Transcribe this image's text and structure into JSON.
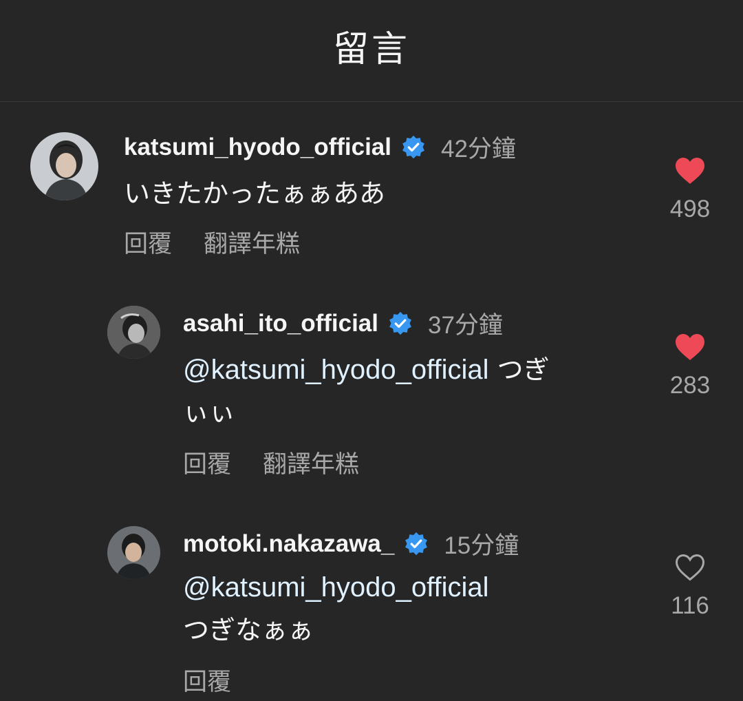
{
  "header": {
    "title": "留言"
  },
  "comments": [
    {
      "username": "katsumi_hyodo_official",
      "verified": true,
      "time": "42分鐘",
      "mention": "",
      "text": "いきたかったぁぁああ",
      "reply_label": "回覆",
      "translate_label": "翻譯年糕",
      "likes": "498",
      "liked": true
    },
    {
      "username": "asahi_ito_official",
      "verified": true,
      "time": "37分鐘",
      "mention": "@katsumi_hyodo_official",
      "text": " つぎぃぃ",
      "reply_label": "回覆",
      "translate_label": "翻譯年糕",
      "likes": "283",
      "liked": true
    },
    {
      "username": "motoki.nakazawa_",
      "verified": true,
      "time": "15分鐘",
      "mention": "@katsumi_hyodo_official",
      "text": "つぎなぁぁ",
      "reply_label": "回覆",
      "translate_label": "",
      "likes": "116",
      "liked": false
    }
  ],
  "colors": {
    "background": "#262626",
    "text_primary": "#f5f5f5",
    "text_secondary": "#a8a8a8",
    "mention": "#e0f1ff",
    "verified_badge": "#3897f0",
    "like_active": "#ed4956"
  },
  "icons": {
    "verified": "verified-badge-icon",
    "liked": "heart-filled-icon",
    "unliked": "heart-outline-icon"
  }
}
